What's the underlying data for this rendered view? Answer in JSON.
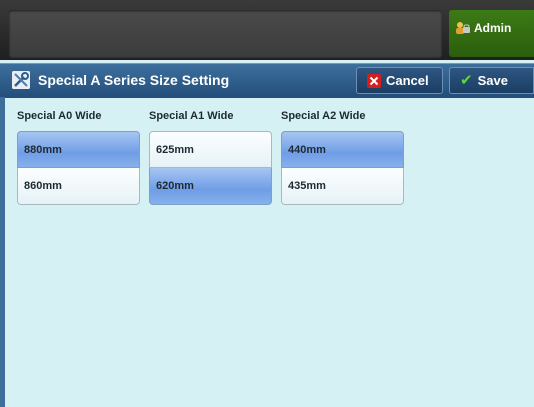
{
  "header": {
    "admin_label": "Admin"
  },
  "titlebar": {
    "title": "Special A Series Size Setting",
    "cancel_label": "Cancel",
    "save_label": "Save"
  },
  "columns": [
    {
      "label": "Special A0 Wide",
      "options": [
        "880mm",
        "860mm"
      ],
      "selected_index": 0
    },
    {
      "label": "Special A1 Wide",
      "options": [
        "625mm",
        "620mm"
      ],
      "selected_index": 1
    },
    {
      "label": "Special A2 Wide",
      "options": [
        "440mm",
        "435mm"
      ],
      "selected_index": 0
    }
  ],
  "colors": {
    "selected": "#7ea6ea",
    "background": "#d6f1f4",
    "titlebar": "#2d5c8a",
    "admin": "#33690f"
  }
}
